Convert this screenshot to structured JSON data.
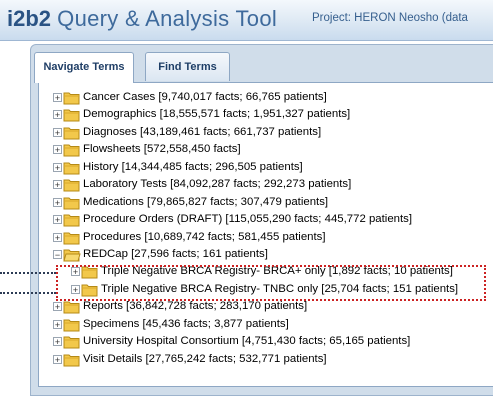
{
  "header": {
    "brand": "i2b2",
    "title": "Query & Analysis Tool",
    "project": "Project: HERON Neosho (data"
  },
  "tabs": [
    {
      "label": "Navigate Terms",
      "active": true
    },
    {
      "label": "Find Terms",
      "active": false
    }
  ],
  "tree": {
    "nodes": [
      {
        "label": "Cancer Cases [9,740,017 facts; 66,765 patients]",
        "level": 0,
        "expander": "+"
      },
      {
        "label": "Demographics [18,555,571 facts; 1,951,327 patients]",
        "level": 0,
        "expander": "+"
      },
      {
        "label": "Diagnoses [43,189,461 facts; 661,737 patients]",
        "level": 0,
        "expander": "+"
      },
      {
        "label": "Flowsheets [572,558,450 facts]",
        "level": 0,
        "expander": "+"
      },
      {
        "label": "History [14,344,485 facts; 296,505 patients]",
        "level": 0,
        "expander": "+"
      },
      {
        "label": "Laboratory Tests [84,092,287 facts; 292,273 patients]",
        "level": 0,
        "expander": "+"
      },
      {
        "label": "Medications [79,865,827 facts; 307,479 patients]",
        "level": 0,
        "expander": "+"
      },
      {
        "label": "Procedure Orders (DRAFT) [115,055,290 facts; 445,772 patients]",
        "level": 0,
        "expander": "+"
      },
      {
        "label": "Procedures [10,689,742 facts; 581,455 patients]",
        "level": 0,
        "expander": "+"
      },
      {
        "label": "REDCap [27,596 facts; 161 patients]",
        "level": 0,
        "expander": "−"
      },
      {
        "label": "Triple Negative BRCA Registry- BRCA+ only [1,892 facts; 10 patients]",
        "level": 1,
        "expander": "+"
      },
      {
        "label": "Triple Negative BRCA Registry- TNBC only [25,704 facts; 151 patients]",
        "level": 1,
        "expander": "+"
      },
      {
        "label": "Reports [36,842,728 facts; 283,170 patients]",
        "level": 0,
        "expander": "+"
      },
      {
        "label": "Specimens [45,436 facts; 3,877 patients]",
        "level": 0,
        "expander": "+"
      },
      {
        "label": "University Hospital Consortium [4,751,430 facts; 65,165 patients]",
        "level": 0,
        "expander": "+"
      },
      {
        "label": "Visit Details [27,765,242 facts; 532,771 patients]",
        "level": 0,
        "expander": "+"
      }
    ]
  },
  "colors": {
    "folder": "#e8b830",
    "highlight": "#cc2222",
    "header": "#2f5a8b"
  }
}
